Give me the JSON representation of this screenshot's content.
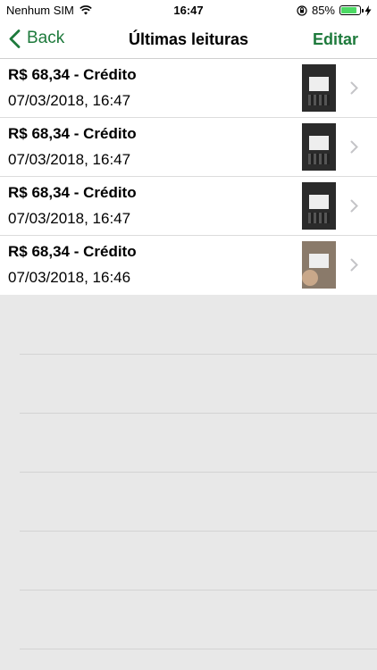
{
  "status_bar": {
    "carrier": "Nenhum SIM",
    "time": "16:47",
    "battery_percent": "85%",
    "battery_level": 0.85,
    "icons": [
      "wifi-icon",
      "orientation-lock-icon",
      "battery-icon",
      "charging-bolt-icon"
    ]
  },
  "nav": {
    "back_label": "Back",
    "title": "Últimas leituras",
    "edit_label": "Editar"
  },
  "readings": [
    {
      "title": "R$ 68,34 - Crédito",
      "date": "07/03/2018, 16:47"
    },
    {
      "title": "R$ 68,34 - Crédito",
      "date": "07/03/2018, 16:47"
    },
    {
      "title": "R$ 68,34 - Crédito",
      "date": "07/03/2018, 16:47"
    },
    {
      "title": "R$ 68,34 - Crédito",
      "date": "07/03/2018, 16:46"
    }
  ],
  "colors": {
    "accent": "#1e7a3c",
    "background": "#e8e8e8",
    "battery": "#4cd964"
  }
}
